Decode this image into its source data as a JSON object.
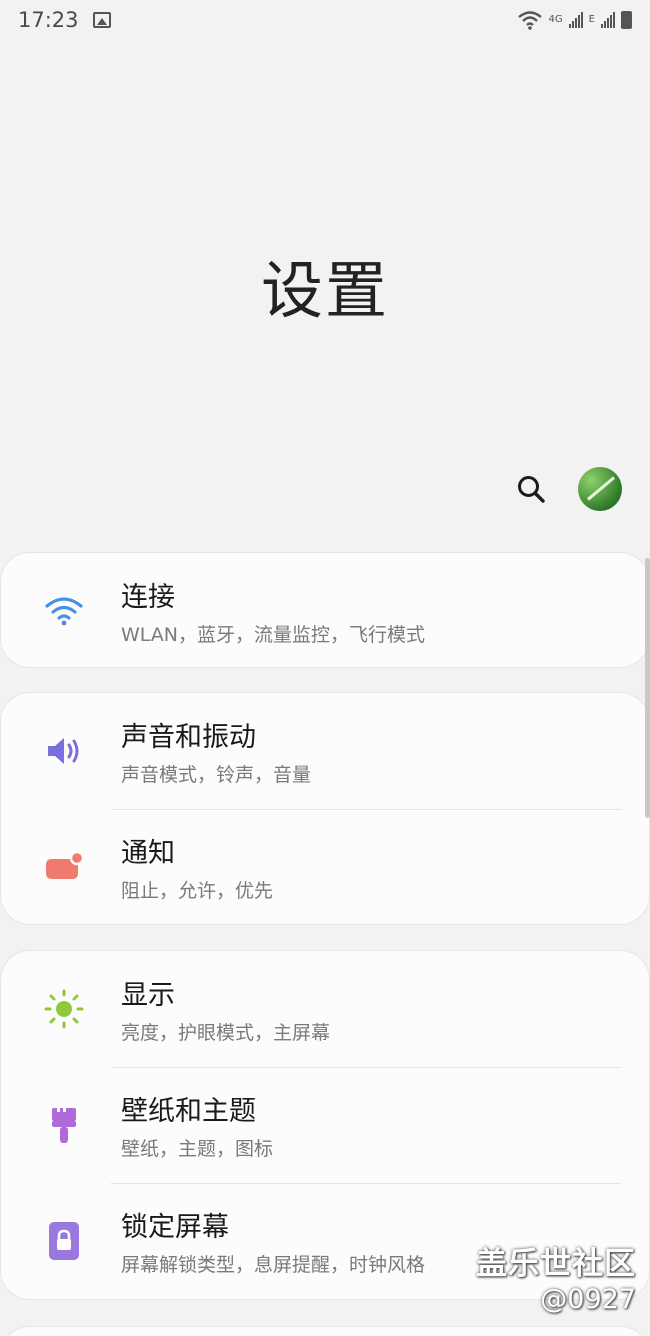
{
  "status_bar": {
    "time": "17:23",
    "net_label_1": "4G",
    "net_label_2": "E",
    "icons": [
      "image-icon",
      "wifi-icon",
      "signal-icon",
      "battery-icon"
    ]
  },
  "page": {
    "title": "设置"
  },
  "header_actions": {
    "search_icon": "search-icon",
    "avatar_icon": "fern-avatar"
  },
  "cards": [
    {
      "items": [
        {
          "title": "连接",
          "subtitle": "WLAN，蓝牙，流量监控，飞行模式",
          "icon": "wifi-icon",
          "color": "#4a90e2"
        }
      ]
    },
    {
      "items": [
        {
          "title": "声音和振动",
          "subtitle": "声音模式，铃声，音量",
          "icon": "speaker-icon",
          "color": "#7b6fe0"
        },
        {
          "title": "通知",
          "subtitle": "阻止，允许，优先",
          "icon": "notification-icon",
          "color": "#f07a6e"
        }
      ]
    },
    {
      "items": [
        {
          "title": "显示",
          "subtitle": "亮度，护眼模式，主屏幕",
          "icon": "sun-icon",
          "color": "#8fc93a"
        },
        {
          "title": "壁纸和主题",
          "subtitle": "壁纸，主题，图标",
          "icon": "brush-icon",
          "color": "#b06ad8"
        },
        {
          "title": "锁定屏幕",
          "subtitle": "屏幕解锁类型，息屏提醒，时钟风格",
          "icon": "lock-icon",
          "color": "#9a78e0"
        }
      ]
    }
  ],
  "watermark": {
    "line1": "盖乐世社区",
    "line2": "@0927"
  }
}
